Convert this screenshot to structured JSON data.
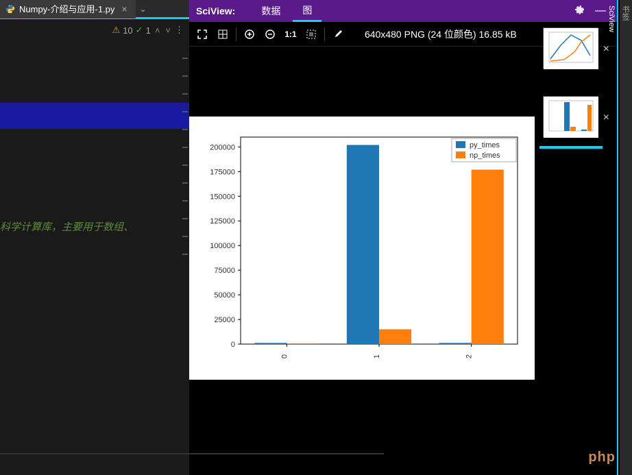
{
  "tab": {
    "filename": "Numpy-介绍与应用-1.py",
    "icon": "python"
  },
  "inspections": {
    "warnings": 10,
    "checks": 1
  },
  "code_snippet": "科学计算库，主要用于数组、",
  "sciview": {
    "title": "SciView:",
    "tabs": [
      "数据",
      "图"
    ],
    "active_tab": 1,
    "image_info": "640x480 PNG (24 位颜色) 16.85 kB"
  },
  "toolbar_icons": [
    "fullscreen",
    "grid",
    "zoom-in",
    "zoom-out",
    "one-to-one",
    "fit",
    "color-picker"
  ],
  "chart_data": {
    "type": "bar",
    "categories": [
      "0",
      "1",
      "2"
    ],
    "series": [
      {
        "name": "py_times",
        "values": [
          1200,
          202000,
          1200
        ],
        "color": "#1f77b4"
      },
      {
        "name": "np_times",
        "values": [
          800,
          15000,
          177000
        ],
        "color": "#ff7f0e"
      }
    ],
    "yticks": [
      0,
      25000,
      50000,
      75000,
      100000,
      125000,
      150000,
      175000,
      200000
    ],
    "ylim": [
      0,
      210000
    ],
    "legend": [
      "py_times",
      "np_times"
    ]
  },
  "thumbnails": [
    {
      "id": 0,
      "type": "line-thumb"
    },
    {
      "id": 1,
      "type": "bar-thumb",
      "active": true
    }
  ],
  "watermark": "php",
  "vertical_tabs": [
    "书签",
    "SciView"
  ]
}
